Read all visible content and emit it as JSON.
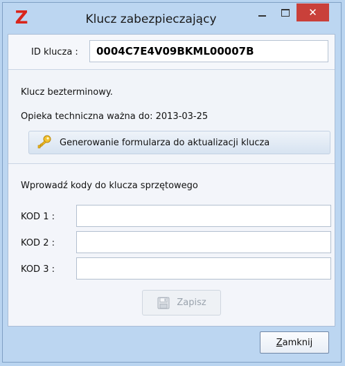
{
  "window": {
    "title": "Klucz zabezpieczający",
    "app_icon_glyph": "Z",
    "close_glyph": "✕"
  },
  "id_row": {
    "label": "ID klucza :",
    "value": "0004C7E4V09BKML00007B"
  },
  "info": {
    "permanent_text": "Klucz bezterminowy.",
    "support_text": "Opieka techniczna ważna do: 2013-03-25",
    "generate_button_label": "Generowanie formularza do aktualizacji klucza",
    "generate_button_icon": "key-icon"
  },
  "codes": {
    "heading": "Wprowadź kody do klucza sprzętowego",
    "fields": [
      {
        "label": "KOD 1 :",
        "value": ""
      },
      {
        "label": "KOD 2 :",
        "value": ""
      },
      {
        "label": "KOD 3 :",
        "value": ""
      }
    ],
    "save_button_label": "Zapisz",
    "save_button_icon": "disk-icon"
  },
  "footer": {
    "close_button_mnemonic": "Z",
    "close_button_rest": "amknij"
  },
  "colors": {
    "window_background": "#bcd6f1",
    "close_button_red": "#c9403a",
    "app_icon_red": "#d9261c"
  }
}
